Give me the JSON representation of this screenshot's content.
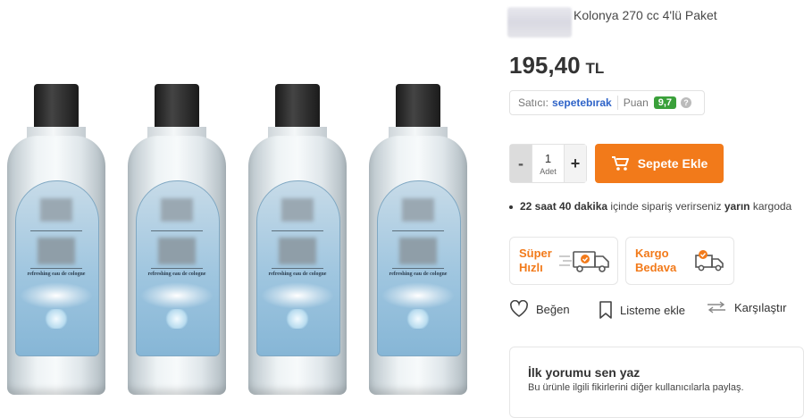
{
  "product": {
    "title": "Kolonya 270 cc 4'lü Paket",
    "bottle_label_text": "refreshing eau de cologne",
    "bottle_count": 4
  },
  "price": {
    "amount": "195,40",
    "currency": "TL"
  },
  "seller": {
    "label": "Satıcı:",
    "name": "sepetebırak",
    "rating_label": "Puan",
    "rating": "9,7",
    "help": "?"
  },
  "quantity": {
    "value": "1",
    "unit": "Adet",
    "minus": "-",
    "plus": "+"
  },
  "cart": {
    "label": "Sepete Ekle"
  },
  "shipping": {
    "time": "22 saat 40 dakika",
    "mid": "içinde sipariş verirseniz",
    "day": "yarın",
    "end": "kargoda"
  },
  "badges": [
    {
      "line1": "Süper",
      "line2": "Hızlı"
    },
    {
      "line1": "Kargo",
      "line2": "Bedava"
    }
  ],
  "actions": {
    "like": "Beğen",
    "list": "Listeme ekle",
    "compare": "Karşılaştır"
  },
  "review": {
    "heading": "İlk yorumu sen yaz",
    "subtext": "Bu ürünle ilgili fikirlerini diğer kullanıcılarla paylaş."
  },
  "colors": {
    "accent": "#f27a1a",
    "seller_link": "#2e63c8",
    "rating_bg": "#3aa03a"
  }
}
